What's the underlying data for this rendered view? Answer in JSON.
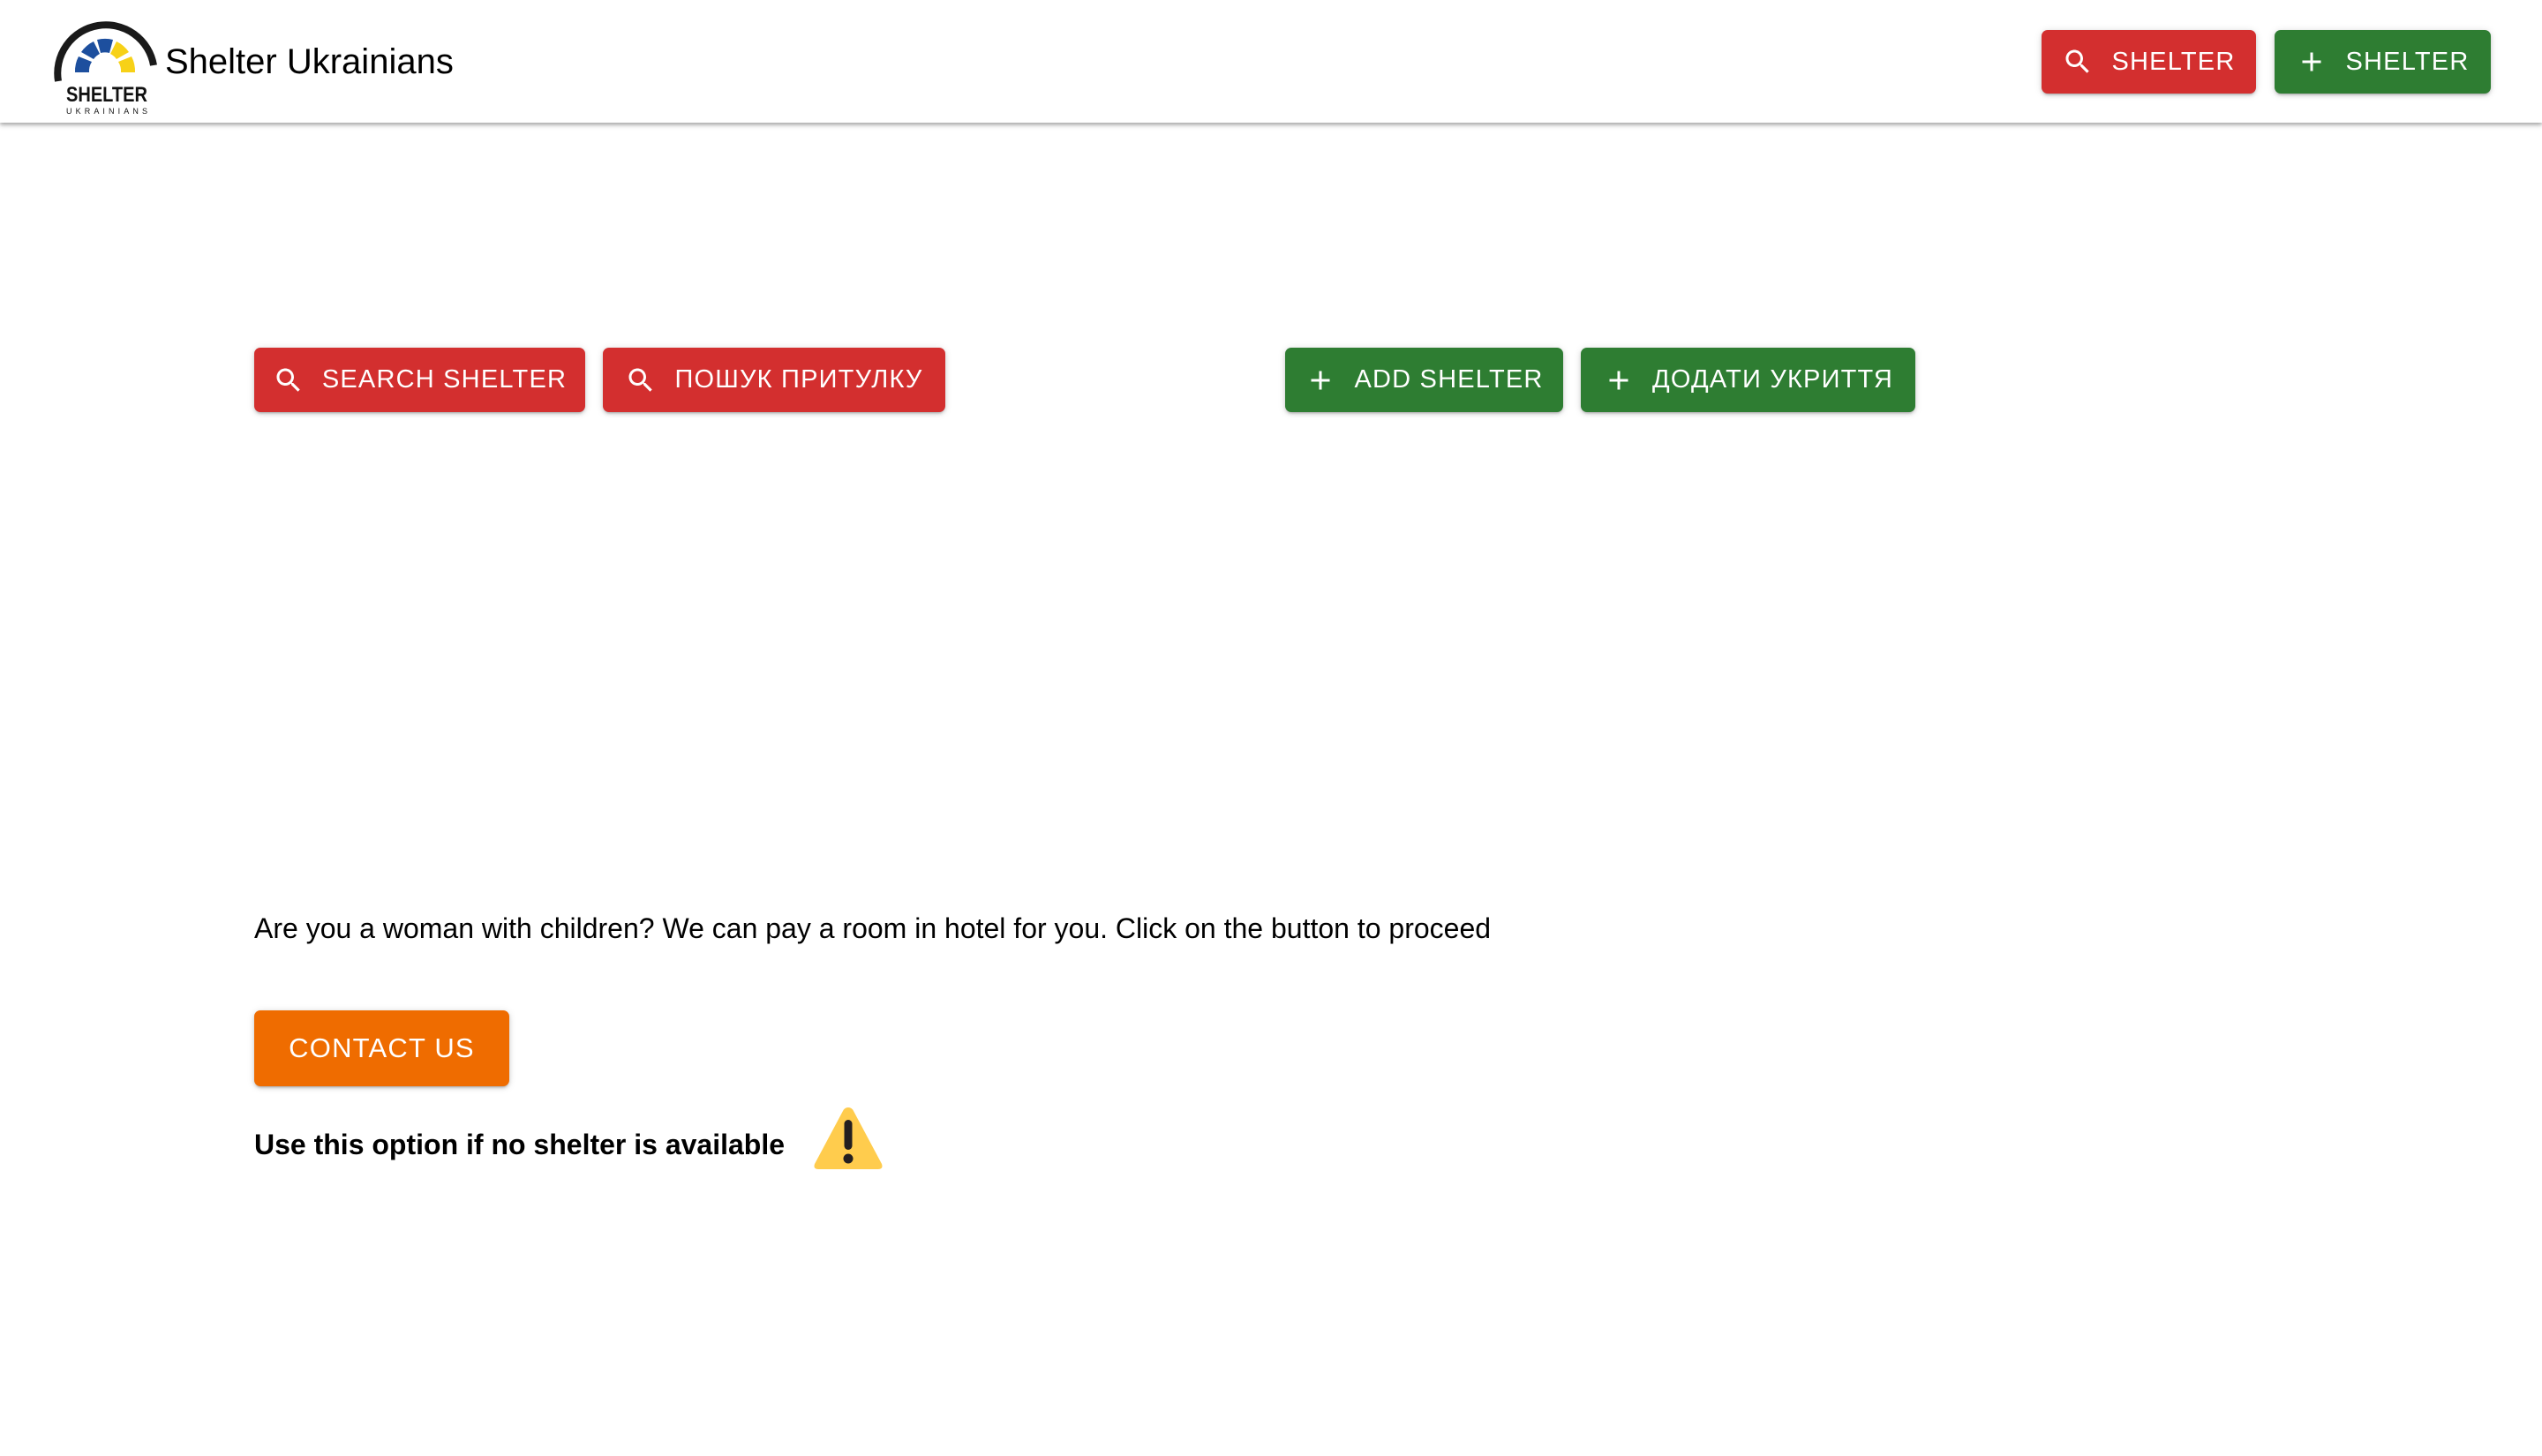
{
  "header": {
    "logo": {
      "icon": "shelter-ukrainians-logo",
      "wordmark": "SHELTER",
      "subwordmark": "UKRAINIANS"
    },
    "title": "Shelter Ukrainians",
    "search_button": {
      "icon": "search-icon",
      "label": "Shelter"
    },
    "add_button": {
      "icon": "plus-icon",
      "label": "Shelter"
    }
  },
  "main": {
    "search_buttons": [
      {
        "icon": "search-icon",
        "label": "Search Shelter"
      },
      {
        "icon": "search-icon",
        "label": "Пошук притулку"
      }
    ],
    "add_buttons": [
      {
        "icon": "plus-icon",
        "label": "Add Shelter"
      },
      {
        "icon": "plus-icon",
        "label": "Додати укриття"
      }
    ],
    "info_text": "Are you a woman with children? We can pay a room in hotel for you. Click on the button to proceed",
    "contact_button": {
      "label": "Contact us"
    },
    "note": "Use this option if no shelter is available",
    "note_icon": "warning-icon"
  },
  "colors": {
    "search": "#d32f2f",
    "add": "#2e7d32",
    "contact": "#ef6c00",
    "logo_blue": "#1d4f9e",
    "logo_yellow": "#f7d117",
    "warning": "#ffcc4d"
  }
}
